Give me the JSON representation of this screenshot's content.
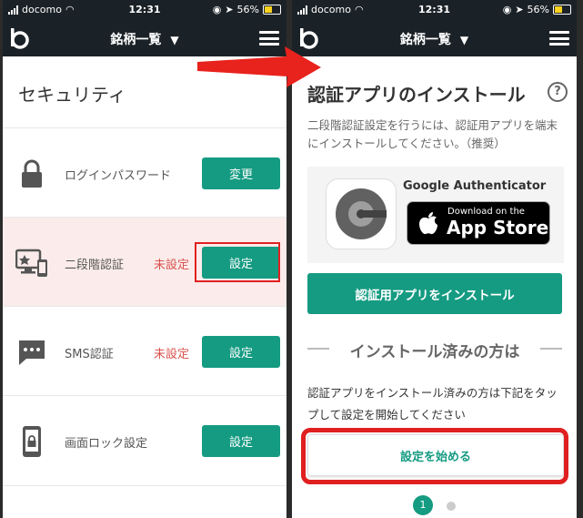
{
  "status_bar": {
    "carrier": "docomo",
    "time": "12:31",
    "battery": "56%"
  },
  "nav": {
    "title": "銘柄一覧"
  },
  "security": {
    "title": "セキュリティ",
    "rows": [
      {
        "label": "ログインパスワード",
        "status": "",
        "button": "変更",
        "icon": "lock-icon"
      },
      {
        "label": "二段階認証",
        "status": "未設定",
        "button": "設定",
        "icon": "monitor-phone-icon"
      },
      {
        "label": "SMS認証",
        "status": "未設定",
        "button": "設定",
        "icon": "chat-bubble-icon"
      },
      {
        "label": "画面ロック設定",
        "status": "",
        "button": "設定",
        "icon": "phone-lock-icon"
      }
    ]
  },
  "install": {
    "title": "認証アプリのインストール",
    "help": "?",
    "description": "二段階認証設定を行うには、認証用アプリを端末にインストールしてください。（推奨）",
    "app_name": "Google Authenticator",
    "appstore_small": "Download on the",
    "appstore_big": "App Store",
    "install_button": "認証用アプリをインストール",
    "divider": "インストール済みの方は",
    "installed_description": "認証アプリをインストール済みの方は下記をタップして設定を開始してください",
    "start_button": "設定を始める",
    "pager_current": "1"
  },
  "colors": {
    "accent": "#159b82",
    "highlight": "#e02020",
    "nav_bg": "#1b2227"
  }
}
